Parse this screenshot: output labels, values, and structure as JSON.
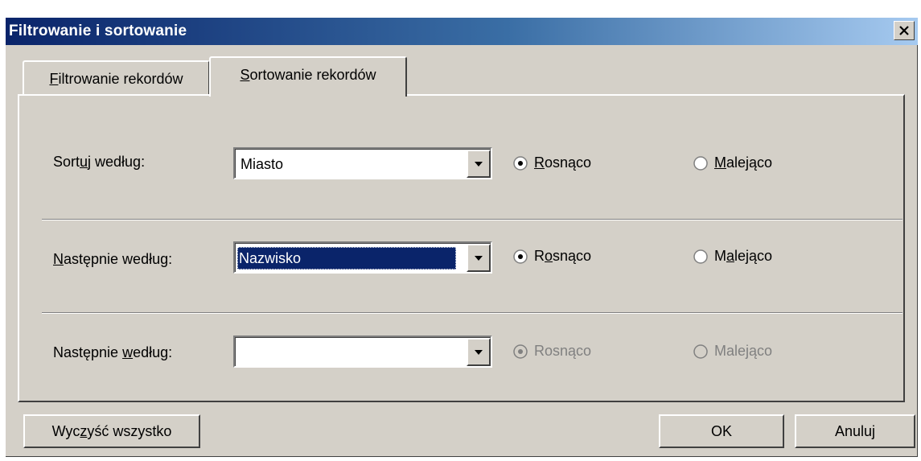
{
  "window": {
    "title": "Filtrowanie i sortowanie",
    "close_icon": "close-icon"
  },
  "tabs": [
    {
      "label": "Filtrowanie rekordów",
      "mnemonic": "F",
      "active": false
    },
    {
      "label": "Sortowanie rekordów",
      "mnemonic": "S",
      "active": true
    }
  ],
  "rows": [
    {
      "label_pre": "Sort",
      "label_mn": "u",
      "label_post": "j według:",
      "value": "Miasto",
      "selected": false,
      "asc_pre": "",
      "asc_mn": "R",
      "asc_post": "osnąco",
      "desc_pre": "",
      "desc_mn": "M",
      "desc_post": "alejąco",
      "checked": "asc",
      "disabled": false
    },
    {
      "label_pre": "",
      "label_mn": "N",
      "label_post": "astępnie według:",
      "value": "Nazwisko",
      "selected": true,
      "asc_pre": "R",
      "asc_mn": "o",
      "asc_post": "snąco",
      "desc_pre": "M",
      "desc_mn": "a",
      "desc_post": "lejąco",
      "checked": "asc",
      "disabled": false
    },
    {
      "label_pre": "Następnie ",
      "label_mn": "w",
      "label_post": "edług:",
      "value": "",
      "selected": false,
      "asc_pre": "Rosnąco",
      "asc_mn": "",
      "asc_post": "",
      "desc_pre": "Malejąco",
      "desc_mn": "",
      "desc_post": "",
      "checked": "asc",
      "disabled": true
    }
  ],
  "buttons": {
    "clear_pre": "Wyc",
    "clear_mn": "z",
    "clear_post": "yść wszystko",
    "ok": "OK",
    "cancel": "Anuluj"
  },
  "colors": {
    "title_gradient_start": "#0a246a",
    "title_gradient_end": "#a6caf0",
    "face": "#d4d0c8",
    "selection": "#0a246a"
  }
}
